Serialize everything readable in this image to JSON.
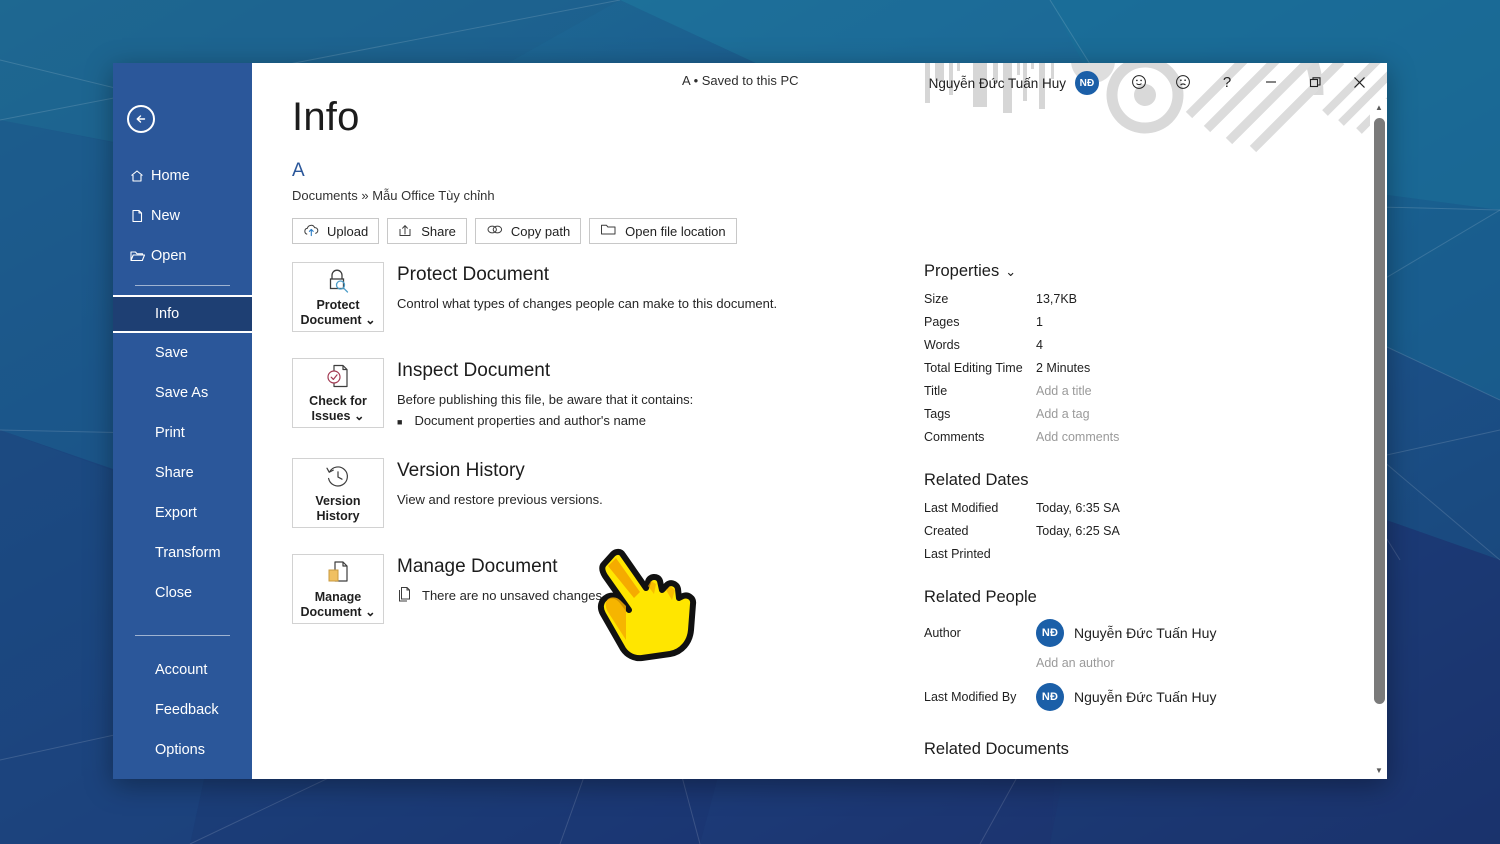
{
  "window": {
    "doc_title": "A • Saved to this PC",
    "account_name": "Nguyễn Đức Tuấn Huy",
    "account_initials": "NĐ",
    "controls": {
      "smiley": "smiley-face-icon",
      "frown": "frowning-face-icon",
      "help": "?",
      "minimize": "—",
      "restore": "restore-icon",
      "close": "✕"
    }
  },
  "sidebar": {
    "back_label": "Back",
    "items": [
      {
        "label": "Home",
        "icon": "home-icon",
        "selected": false,
        "has_icon": true
      },
      {
        "label": "New",
        "icon": "new-document-icon",
        "selected": false,
        "has_icon": true
      },
      {
        "label": "Open",
        "icon": "open-folder-icon",
        "selected": false,
        "has_icon": true
      },
      {
        "label": "Info",
        "icon": "",
        "selected": true,
        "has_icon": false
      },
      {
        "label": "Save",
        "icon": "",
        "selected": false,
        "has_icon": false
      },
      {
        "label": "Save As",
        "icon": "",
        "selected": false,
        "has_icon": false
      },
      {
        "label": "Print",
        "icon": "",
        "selected": false,
        "has_icon": false
      },
      {
        "label": "Share",
        "icon": "",
        "selected": false,
        "has_icon": false
      },
      {
        "label": "Export",
        "icon": "",
        "selected": false,
        "has_icon": false
      },
      {
        "label": "Transform",
        "icon": "",
        "selected": false,
        "has_icon": false
      },
      {
        "label": "Close",
        "icon": "",
        "selected": false,
        "has_icon": false
      },
      {
        "label": "Account",
        "icon": "",
        "selected": false,
        "has_icon": false
      },
      {
        "label": "Feedback",
        "icon": "",
        "selected": false,
        "has_icon": false
      },
      {
        "label": "Options",
        "icon": "",
        "selected": false,
        "has_icon": false
      }
    ],
    "accent": "#2b579a",
    "selected_bg": "#1e3f73"
  },
  "main": {
    "page_title": "Info",
    "file_name": "A",
    "file_path": "Documents » Mẫu Office Tùy chỉnh",
    "quick_buttons": [
      {
        "label": "Upload",
        "icon": "upload-cloud-icon"
      },
      {
        "label": "Share",
        "icon": "share-icon"
      },
      {
        "label": "Copy path",
        "icon": "link-icon"
      },
      {
        "label": "Open file location",
        "icon": "folder-open-icon"
      }
    ],
    "sections": [
      {
        "button_label_line1": "Protect",
        "button_label_line2": "Document",
        "button_caret": "⌄",
        "button_icon": "lock-key-icon",
        "title": "Protect Document",
        "desc": "Control what types of changes people can make to this document.",
        "bullets": [],
        "note": null
      },
      {
        "button_label_line1": "Check for",
        "button_label_line2": "Issues",
        "button_caret": "⌄",
        "button_icon": "document-check-icon",
        "title": "Inspect Document",
        "desc": "Before publishing this file, be aware that it contains:",
        "bullets": [
          "Document properties and author's name"
        ],
        "note": null
      },
      {
        "button_label_line1": "Version",
        "button_label_line2": "History",
        "button_caret": "",
        "button_icon": "clock-history-icon",
        "title": "Version History",
        "desc": "View and restore previous versions.",
        "bullets": [],
        "note": null
      },
      {
        "button_label_line1": "Manage",
        "button_label_line2": "Document",
        "button_caret": "⌄",
        "button_icon": "manage-document-icon",
        "title": "Manage Document",
        "desc": "",
        "bullets": [],
        "note": {
          "icon": "unsaved-changes-icon",
          "text": "There are no unsaved changes."
        }
      }
    ]
  },
  "properties": {
    "heading": "Properties",
    "caret": "⌄",
    "rows": [
      {
        "key": "Size",
        "value": "13,7KB",
        "placeholder": false
      },
      {
        "key": "Pages",
        "value": "1",
        "placeholder": false
      },
      {
        "key": "Words",
        "value": "4",
        "placeholder": false
      },
      {
        "key": "Total Editing Time",
        "value": "2 Minutes",
        "placeholder": false
      },
      {
        "key": "Title",
        "value": "Add a title",
        "placeholder": true
      },
      {
        "key": "Tags",
        "value": "Add a tag",
        "placeholder": true
      },
      {
        "key": "Comments",
        "value": "Add comments",
        "placeholder": true
      }
    ],
    "related_dates": {
      "heading": "Related Dates",
      "rows": [
        {
          "key": "Last Modified",
          "value": "Today, 6:35 SA"
        },
        {
          "key": "Created",
          "value": "Today, 6:25 SA"
        },
        {
          "key": "Last Printed",
          "value": ""
        }
      ]
    },
    "related_people": {
      "heading": "Related People",
      "author_key": "Author",
      "author_name": "Nguyễn Đức Tuấn Huy",
      "author_initials": "NĐ",
      "add_author": "Add an author",
      "modified_key": "Last Modified By",
      "modified_name": "Nguyễn Đức Tuấn Huy",
      "modified_initials": "NĐ"
    },
    "related_documents": {
      "heading": "Related Documents"
    }
  },
  "scrollbar": {
    "up": "▲",
    "down": "▼"
  },
  "cursor": {
    "type": "pointing-hand-cursor",
    "fill": "#ffe600",
    "shadow": "#f0a800"
  }
}
